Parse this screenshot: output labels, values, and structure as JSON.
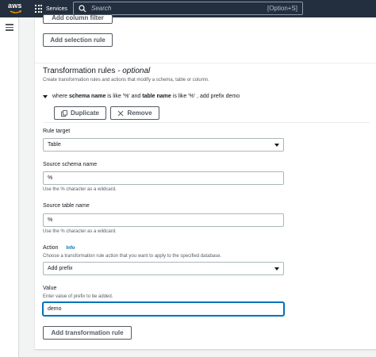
{
  "topbar": {
    "logo": "aws",
    "services_label": "Services",
    "search_placeholder": "Search",
    "search_shortcut": "[Option+S]"
  },
  "top_buttons": {
    "add_column_filter": "Add column filter",
    "add_selection_rule": "Add selection rule"
  },
  "section": {
    "title": "Transformation rules",
    "optional": "- optional",
    "description": "Create transformation rules and actions that modify a schema, table or column."
  },
  "rule": {
    "where": "where",
    "schema_name": "schema name",
    "is_like_1": "is like '%' and",
    "table_name": "table name",
    "is_like_2": "is like '%' , add prefix demo",
    "duplicate_label": "Duplicate",
    "remove_label": "Remove"
  },
  "form": {
    "rule_target": {
      "label": "Rule target",
      "value": "Table"
    },
    "source_schema": {
      "label": "Source schema name",
      "value": "%",
      "hint": "Use the % character as a wildcard."
    },
    "source_table": {
      "label": "Source table name",
      "value": "%",
      "hint": "Use the % character as a wildcard."
    },
    "action": {
      "label": "Action",
      "info": "Info",
      "hint": "Choose a transformation rule action that you want to apply to the specified database.",
      "value": "Add prefix"
    },
    "value": {
      "label": "Value",
      "hint": "Enter value of prefix to be added.",
      "value": "demo"
    }
  },
  "add_transformation_rule": "Add transformation rule",
  "colors": {
    "topbar": "#232f3e",
    "link": "#0073bb",
    "focus": "#0073bb"
  }
}
